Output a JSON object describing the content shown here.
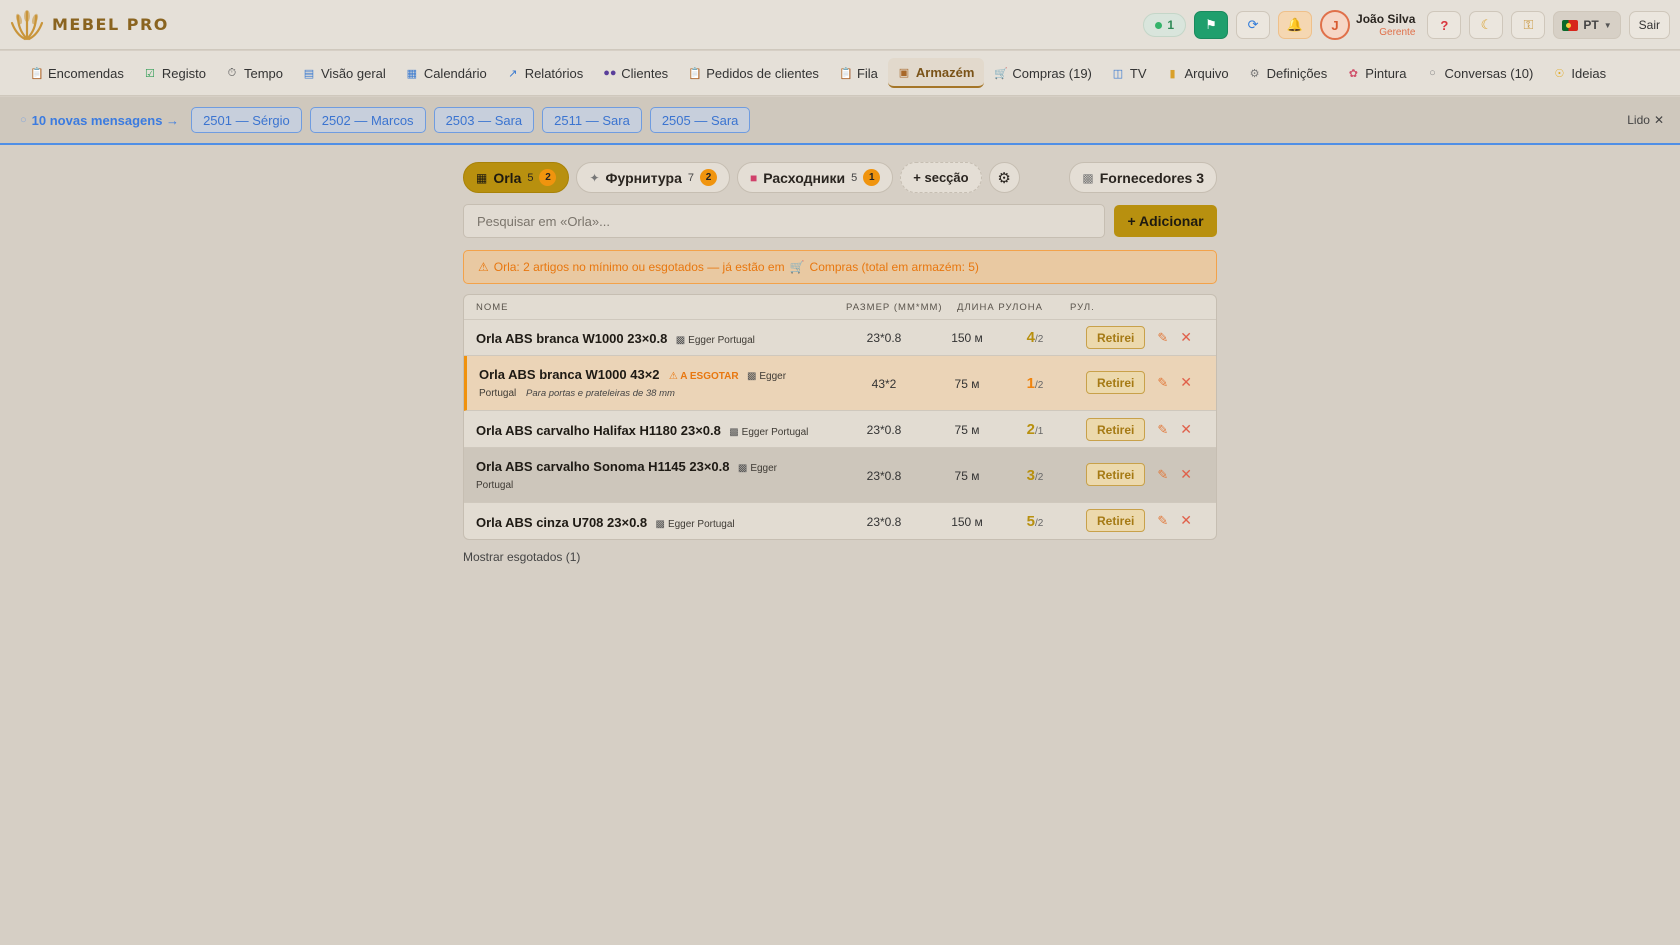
{
  "app": {
    "brand": "MEBEL PRO"
  },
  "header": {
    "online_count": "1",
    "user_initial": "J",
    "user_name": "João Silva",
    "user_role": "Gerente",
    "help_label": "?",
    "language": "PT",
    "logout_label": "Sair"
  },
  "nav": {
    "items": [
      {
        "label": "Encomendas",
        "icon": "clipboard-icon"
      },
      {
        "label": "Registo",
        "icon": "checkbox-icon"
      },
      {
        "label": "Tempo",
        "icon": "stopwatch-icon"
      },
      {
        "label": "Visão geral",
        "icon": "bar-chart-icon"
      },
      {
        "label": "Calendário",
        "icon": "calendar-icon"
      },
      {
        "label": "Relatórios",
        "icon": "trend-chart-icon"
      },
      {
        "label": "Clientes",
        "icon": "people-icon"
      },
      {
        "label": "Pedidos de clientes",
        "icon": "clipboard-icon"
      },
      {
        "label": "Fila",
        "icon": "clipboard-icon"
      },
      {
        "label": "Armazém",
        "icon": "box-icon",
        "active": true
      },
      {
        "label": "Compras (19)",
        "icon": "cart-icon"
      },
      {
        "label": "TV",
        "icon": "tv-icon"
      },
      {
        "label": "Arquivo",
        "icon": "folder-icon"
      },
      {
        "label": "Definições",
        "icon": "gear-icon"
      },
      {
        "label": "Pintura",
        "icon": "palette-icon"
      },
      {
        "label": "Conversas (10)",
        "icon": "speech-bubble-icon"
      },
      {
        "label": "Ideias",
        "icon": "lightbulb-icon"
      }
    ]
  },
  "messages": {
    "lead": "10 novas mensagens →",
    "chips": [
      "2501 — Sérgio",
      "2502 — Marcos",
      "2503 — Sara",
      "2511 — Sara",
      "2505 — Sara"
    ],
    "dismiss_label": "Lido"
  },
  "warehouse": {
    "tabs": [
      {
        "label": "Orla",
        "count": "5",
        "badge": "2",
        "active": true
      },
      {
        "label": "Фурнитура",
        "count": "7",
        "badge": "2"
      },
      {
        "label": "Расходники",
        "count": "5",
        "badge": "1"
      }
    ],
    "add_section_label": "+ secção",
    "suppliers_label": "Fornecedores 3",
    "search_placeholder": "Pesquisar em «Orla»...",
    "add_button_label": "+ Adicionar",
    "alert_text": "Orla: 2 artigos no mínimo ou esgotados — já estão em",
    "alert_link": "Compras (total em armazém: 5)",
    "columns": {
      "name": "NOME",
      "size": "РАЗМЕР (ММ*ММ)",
      "length": "ДЛИНА РУЛОНА",
      "rolls": "РУЛ."
    },
    "rows": [
      {
        "name": "Orla ABS branca W1000 23×0.8",
        "supplier": "Egger Portugal",
        "size": "23*0.8",
        "length": "150 м",
        "rolls": "4",
        "min": "/2"
      },
      {
        "name": "Orla ABS branca W1000 43×2",
        "tag": "A ESGOTAR",
        "supplier_a": "Egger",
        "supplier_b": "Portugal",
        "note": "Para portas e prateleiras de 38 mm",
        "size": "43*2",
        "length": "75 м",
        "rolls": "1",
        "min": "/2"
      },
      {
        "name": "Orla ABS carvalho Halifax H1180 23×0.8",
        "supplier": "Egger Portugal",
        "size": "23*0.8",
        "length": "75 м",
        "rolls": "2",
        "min": "/1"
      },
      {
        "name": "Orla ABS carvalho Sonoma H1145 23×0.8",
        "supplier_a": "Egger",
        "supplier_b": "Portugal",
        "size": "23*0.8",
        "length": "75 м",
        "rolls": "3",
        "min": "/2"
      },
      {
        "name": "Orla ABS cinza U708 23×0.8",
        "supplier": "Egger Portugal",
        "size": "23*0.8",
        "length": "150 м",
        "rolls": "5",
        "min": "/2"
      }
    ],
    "retirei_label": "Retirei",
    "show_sold_label": "Mostrar esgotados (1)"
  },
  "colors": {
    "accent": "#b8900f",
    "brand": "#8a6420",
    "warning": "#f0920e",
    "message_blue": "#3b7be0",
    "online_green": "#34b36a"
  }
}
